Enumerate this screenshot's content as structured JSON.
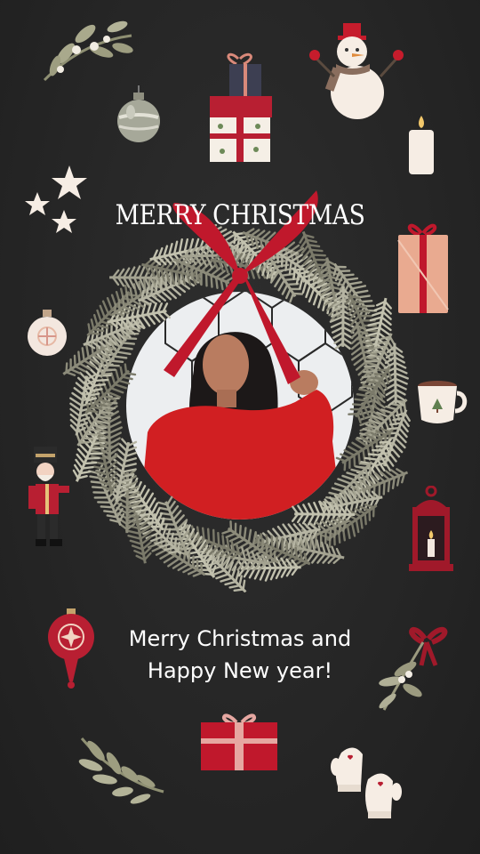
{
  "card": {
    "title": "MERRY CHRISTMAS",
    "greeting_line_1": "Merry Christmas and",
    "greeting_line_2": "Happy New year!"
  },
  "colors": {
    "background": "#262626",
    "accent_red": "#c0182c",
    "wreath_green": "#9d9c8a",
    "text": "#ffffff"
  },
  "decorations": [
    "mistletoe-icon",
    "bauble-icon",
    "gift-stack-icon",
    "snowman-icon",
    "candle-icon",
    "stars-icon",
    "gift-box-icon",
    "ornament-icon",
    "cocoa-mug-icon",
    "nutcracker-icon",
    "lantern-icon",
    "red-ornament-icon",
    "mistletoe-bow-icon",
    "red-gift-icon",
    "branch-icon",
    "mittens-icon"
  ]
}
